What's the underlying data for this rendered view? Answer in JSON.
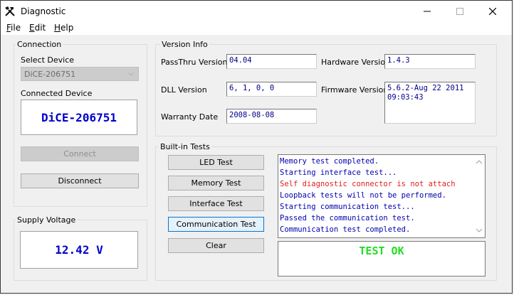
{
  "window": {
    "title": "Diagnostic",
    "icon": "tools-icon",
    "controls": {
      "minimize": "—",
      "maximize": "☐",
      "close": "✕"
    }
  },
  "menu": [
    "File",
    "Edit",
    "Help"
  ],
  "connection": {
    "label": "Connection",
    "select_device_label": "Select Device",
    "selected_device": "DiCE-206751",
    "connected_device_label": "Connected Device",
    "connected_device": "DiCE-206751",
    "connect_button": "Connect",
    "disconnect_button": "Disconnect"
  },
  "supply": {
    "label": "Supply Voltage",
    "value": "12.42 V"
  },
  "version_info": {
    "label": "Version Info",
    "passthru_label": "PassThru Version",
    "passthru_value": "04.04",
    "dll_label": "DLL Version",
    "dll_value": "6, 1, 0, 0",
    "warranty_label": "Warranty Date",
    "warranty_value": "2008-08-08",
    "hardware_label": "Hardware Version",
    "hardware_value": "1.4.3",
    "firmware_label": "Firmware Version",
    "firmware_value": "5.6.2-Aug 22 2011\n09:03:43"
  },
  "tests": {
    "label": "Built-in Tests",
    "buttons": [
      "LED Test",
      "Memory Test",
      "Interface Test",
      "Communication Test",
      "Clear"
    ],
    "log": [
      {
        "text": "Memory test completed.",
        "color": "#0000b0"
      },
      {
        "text": "Starting interface test...",
        "color": "#0000b0"
      },
      {
        "text": "Self diagnostic connector is not attach",
        "color": "#e02020"
      },
      {
        "text": "Loopback tests will not be performed.",
        "color": "#0000b0"
      },
      {
        "text": "Starting communication test...",
        "color": "#0000b0"
      },
      {
        "text": "Passed the communication test.",
        "color": "#0000b0"
      },
      {
        "text": "Communication test completed.",
        "color": "#0000b0"
      }
    ],
    "result": "TEST OK",
    "result_color": "#22dd22"
  }
}
